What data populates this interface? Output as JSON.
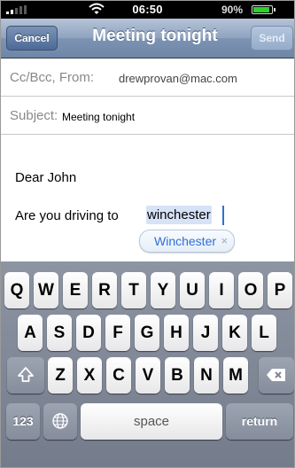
{
  "status_bar": {
    "time": "06:50",
    "battery": "90%",
    "battery_fraction": 0.9,
    "signal_bars": 2
  },
  "nav": {
    "cancel": "Cancel",
    "title": "Meeting tonight",
    "send": "Send"
  },
  "compose": {
    "cc_label": "Cc/Bcc, From:",
    "from_value": "drewprovan@mac.com",
    "subject_label": "Subject:",
    "subject_value": "Meeting tonight",
    "body_line1": "Dear John",
    "body_prefix": "Are you driving to",
    "typed_word": "winchester",
    "suggestion": "Winchester",
    "dismiss_glyph": "×"
  },
  "keyboard": {
    "row1": [
      "Q",
      "W",
      "E",
      "R",
      "T",
      "Y",
      "U",
      "I",
      "O",
      "P"
    ],
    "row2": [
      "A",
      "S",
      "D",
      "F",
      "G",
      "H",
      "J",
      "K",
      "L"
    ],
    "row3": [
      "Z",
      "X",
      "C",
      "V",
      "B",
      "N",
      "M"
    ],
    "numbers_key": "123",
    "space_key": "space",
    "return_key": "return",
    "icons": {
      "shift": "shift-icon",
      "backspace": "backspace-icon",
      "globe": "globe-icon"
    }
  }
}
